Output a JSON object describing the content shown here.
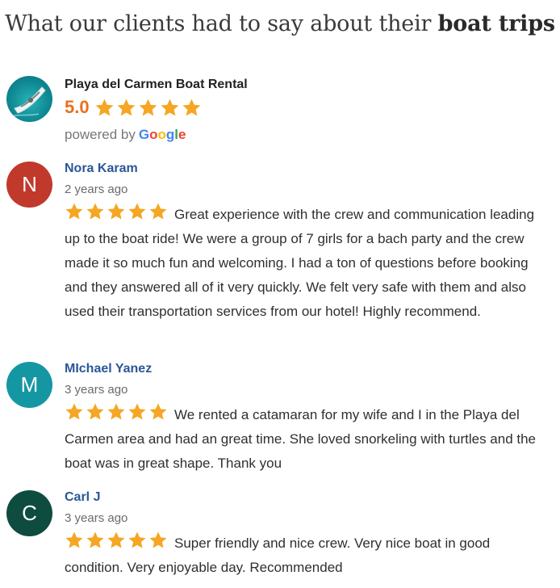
{
  "header": {
    "title_prefix": "What our clients had to say about their ",
    "title_bold": "boat trips"
  },
  "business": {
    "avatar_icon": "boat-photo-icon",
    "name": "Playa del Carmen Boat Rental",
    "rating": "5.0",
    "stars": 5,
    "powered_by": "powered by",
    "google_letters": [
      "G",
      "o",
      "o",
      "g",
      "l",
      "e"
    ]
  },
  "colors": {
    "star": "#f5a623",
    "rating": "#e7711b",
    "reviewer_name": "#2b5797"
  },
  "reviews": [
    {
      "initial": "N",
      "avatar_color": "#c0392b",
      "name": "Nora Karam",
      "time": "2 years ago",
      "stars": 5,
      "text": "Great experience with the crew and communication leading up to the boat ride! We were a group of 7 girls for a bach party and the crew made it so much fun and welcoming. I had a ton of questions before booking and they answered all of it very quickly. We felt very safe with them and also used their transportation services from our hotel! Highly recommend."
    },
    {
      "initial": "M",
      "avatar_color": "#1497a3",
      "name": "MIchael Yanez",
      "time": "3 years ago",
      "stars": 5,
      "text": "We rented a catamaran for my wife and I in the Playa del Carmen area and had an great time.  She loved snorkeling with turtles and the boat was in great shape.  Thank you"
    },
    {
      "initial": "C",
      "avatar_color": "#0f4c40",
      "name": "Carl J",
      "time": "3 years ago",
      "stars": 5,
      "text": "Super friendly and nice crew. Very nice boat in good condition. Very enjoyable day. Recommended"
    }
  ]
}
